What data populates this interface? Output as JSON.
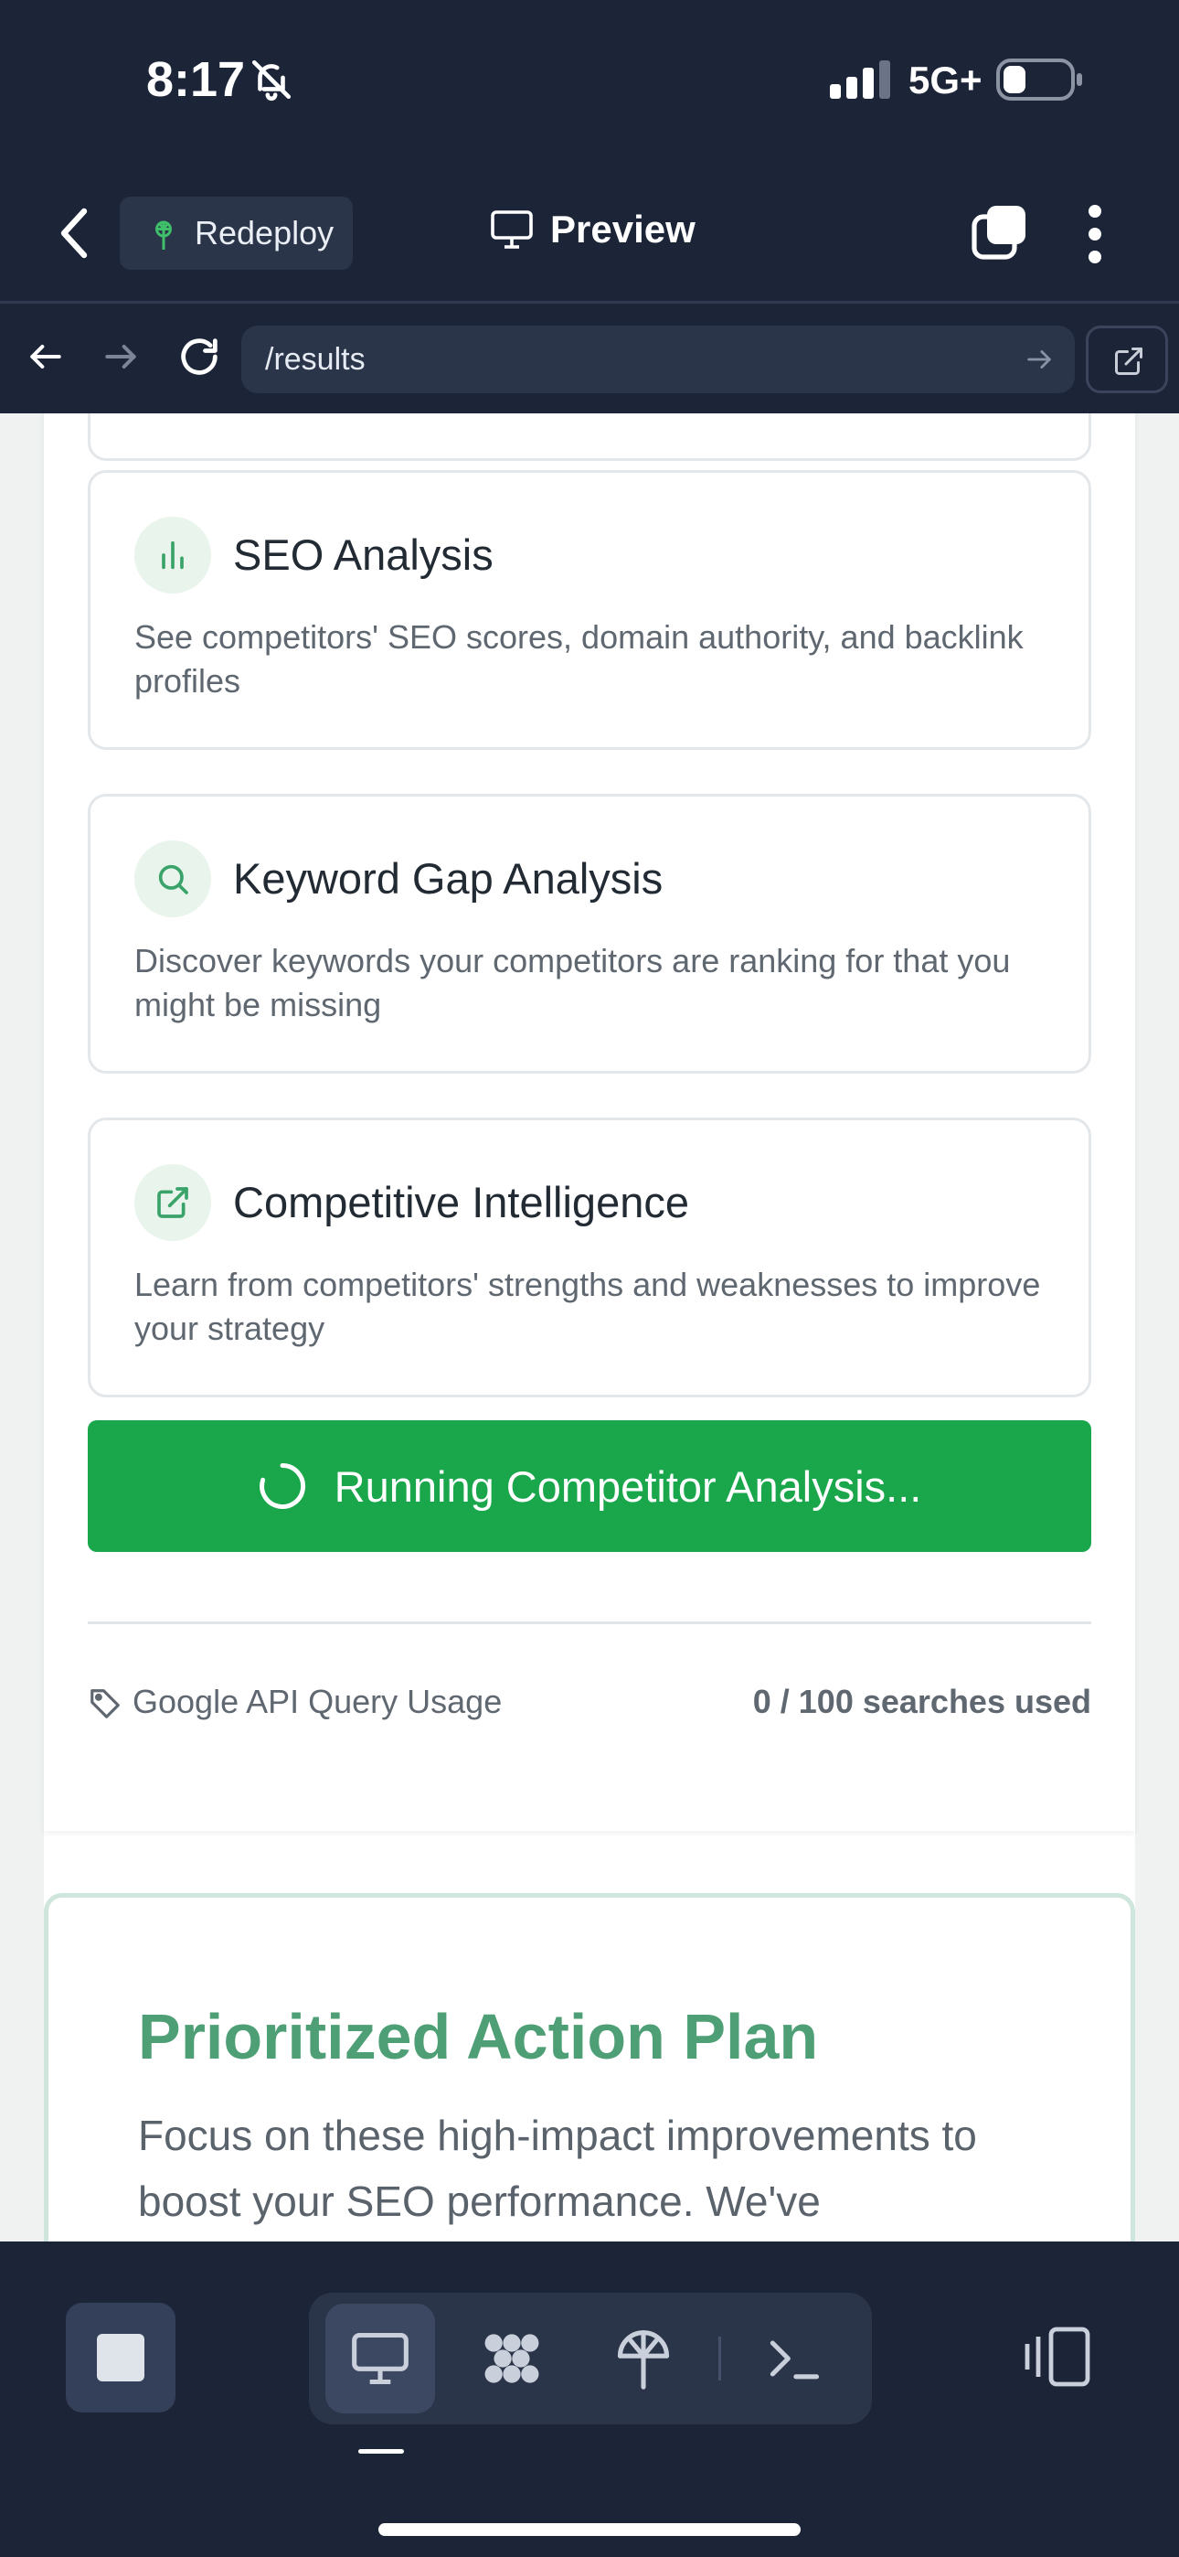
{
  "status_bar": {
    "time": "8:17",
    "network": "5G+"
  },
  "header": {
    "redeploy_label": "Redeploy",
    "title": "Preview"
  },
  "browser": {
    "url": "/results"
  },
  "features": [
    {
      "icon": "bar-chart-icon",
      "title": "SEO Analysis",
      "description": "See competitors' SEO scores, domain authority, and backlink profiles"
    },
    {
      "icon": "search-icon",
      "title": "Keyword Gap Analysis",
      "description": "Discover keywords your competitors are ranking for that you might be missing"
    },
    {
      "icon": "external-link-icon",
      "title": "Competitive Intelligence",
      "description": "Learn from competitors' strengths and weaknesses to improve your strategy"
    }
  ],
  "run_button_label": "Running Competitor Analysis...",
  "usage": {
    "label": "Google API Query Usage",
    "value": "0 / 100 searches used"
  },
  "action_plan": {
    "title": "Prioritized Action Plan",
    "description": "Focus on these high-impact improvements to boost your SEO performance. We've"
  },
  "colors": {
    "accent_green": "#1aa64b",
    "heading_green": "#4e9f76",
    "chrome": "#1c2438"
  }
}
